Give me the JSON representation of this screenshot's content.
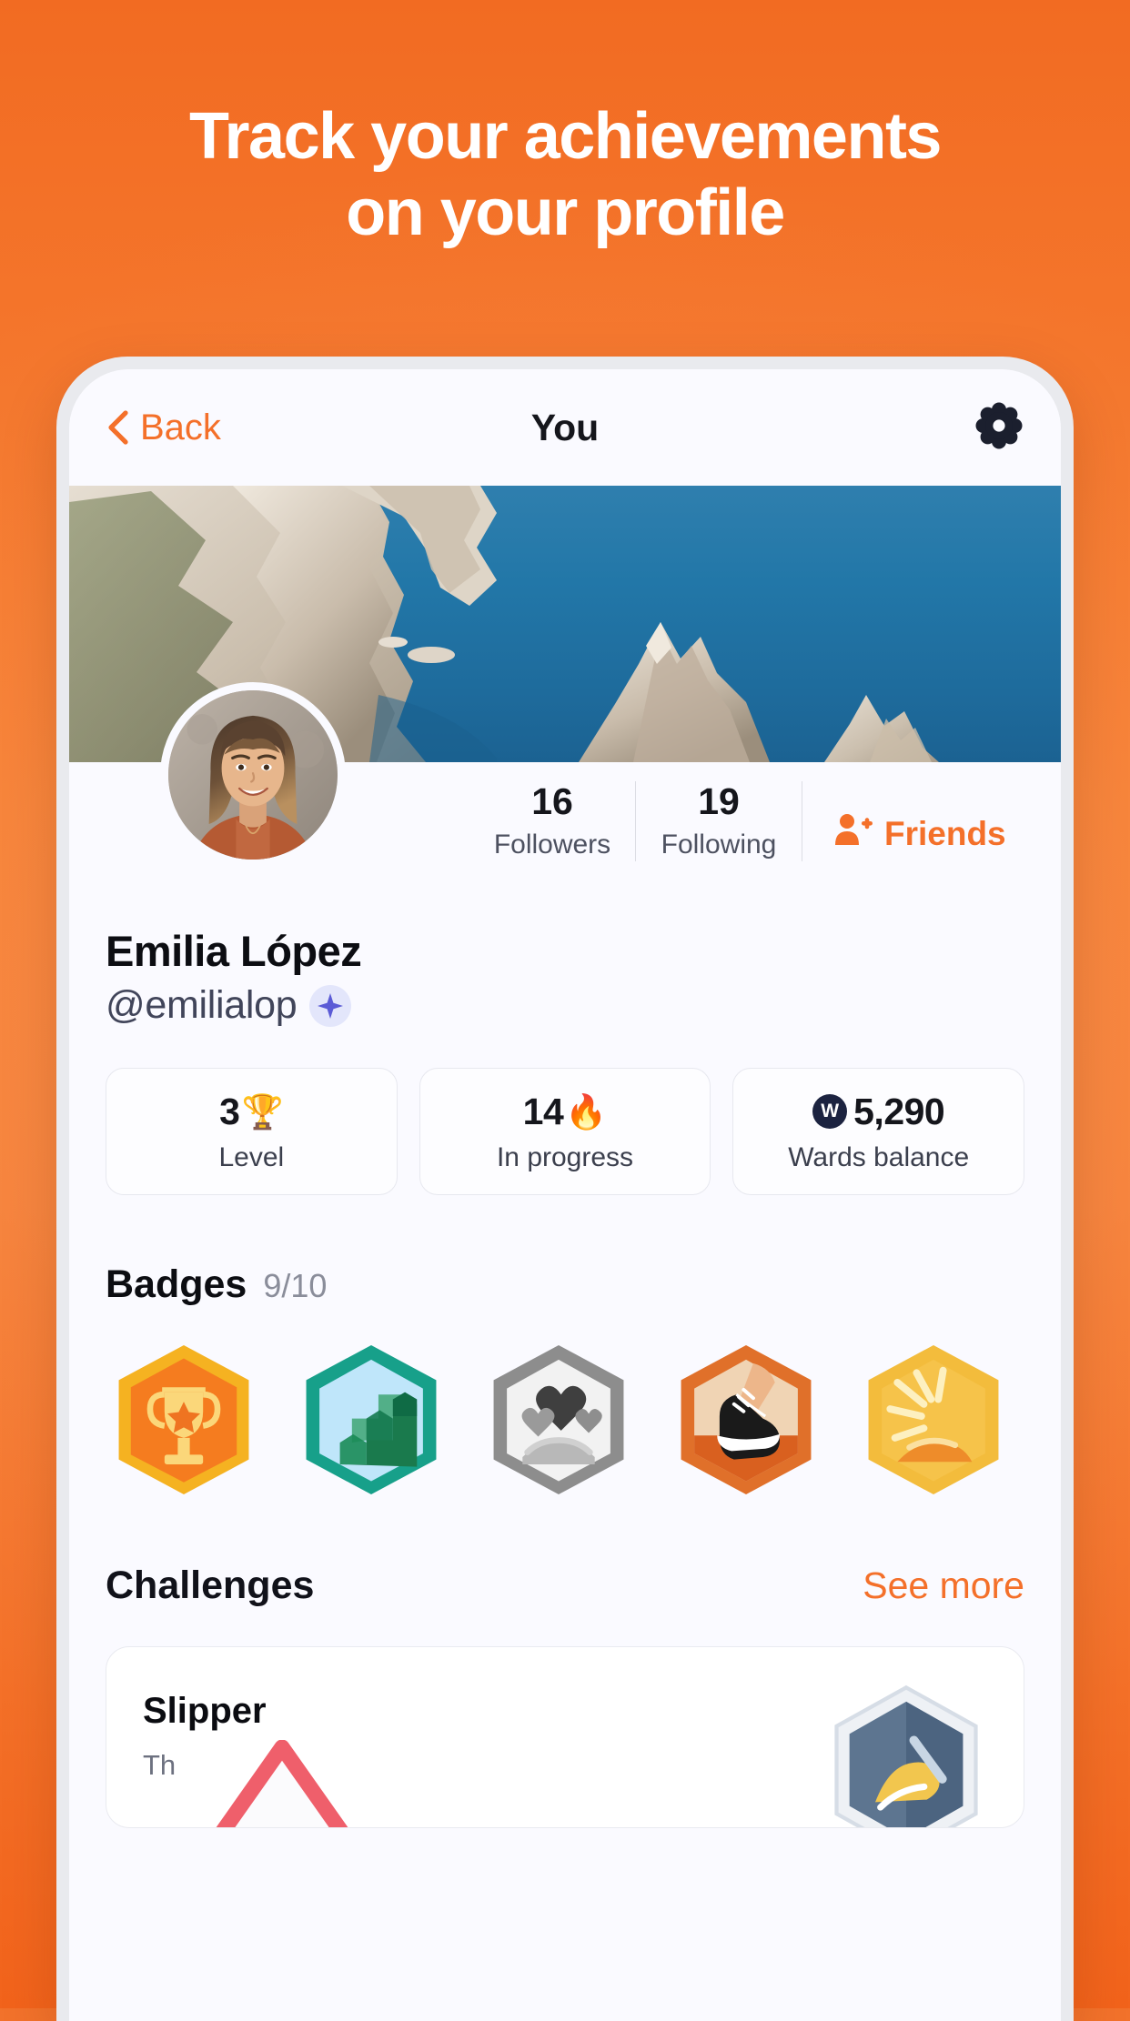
{
  "promo": {
    "headline_line1": "Track your achievements",
    "headline_line2": "on your profile",
    "background_color": "#f2722b",
    "headline_color": "#ffffff"
  },
  "nav": {
    "back_label": "Back",
    "title": "You",
    "settings_icon": "gear-icon",
    "back_icon": "chevron-left-icon",
    "accent_color": "#f4702a"
  },
  "profile": {
    "cover_photo_alt": "coastal limestone cliffs over turquoise sea",
    "avatar_alt": "smiling woman with bangs in rust top",
    "display_name": "Emilia López",
    "handle": "@emilialop",
    "verified_icon": "sparkle-badge-icon",
    "verified_badge_color": "#5b5bd6",
    "stats": [
      {
        "value": "16",
        "label": "Followers"
      },
      {
        "value": "19",
        "label": "Following"
      }
    ],
    "friends_label": "Friends",
    "friends_icon": "person-add-icon"
  },
  "stat_cards": [
    {
      "value": "3",
      "emoji": "🏆",
      "caption": "Level",
      "icon": "trophy-icon",
      "coin": false
    },
    {
      "value": "14",
      "emoji": "🔥",
      "caption": "In progress",
      "icon": "fire-icon",
      "coin": false
    },
    {
      "value": "5,290",
      "emoji": "",
      "caption": "Wards balance",
      "icon": "wards-coin-icon",
      "coin": true,
      "coin_letter": "W"
    }
  ],
  "badges": {
    "title": "Badges",
    "count": "9/10",
    "items": [
      {
        "name": "trophy-badge",
        "color": "#f57c1f",
        "ring": "#f5b221",
        "icon": "trophy-icon"
      },
      {
        "name": "stairs-badge",
        "color": "#bfe6fa",
        "ring": "#17a08a",
        "icon": "stairs-icon"
      },
      {
        "name": "hearts-in-hand-badge",
        "color": "#f2f2f2",
        "ring": "#8d8d8d",
        "icon": "hand-hearts-icon"
      },
      {
        "name": "sneaker-badge",
        "color": "#f0d4b4",
        "ring": "#e0702a",
        "icon": "sneaker-icon"
      },
      {
        "name": "sunburst-badge",
        "color": "#f6c34a",
        "ring": "#f3bc3c",
        "icon": "sunburst-icon"
      }
    ]
  },
  "challenges": {
    "title": "Challenges",
    "see_more_label": "See more",
    "items": [
      {
        "name": "Slipper",
        "subtitle": "Th",
        "badge_icon": "slipper-hex-badge-icon",
        "badge_color": "#5d7590"
      }
    ]
  }
}
